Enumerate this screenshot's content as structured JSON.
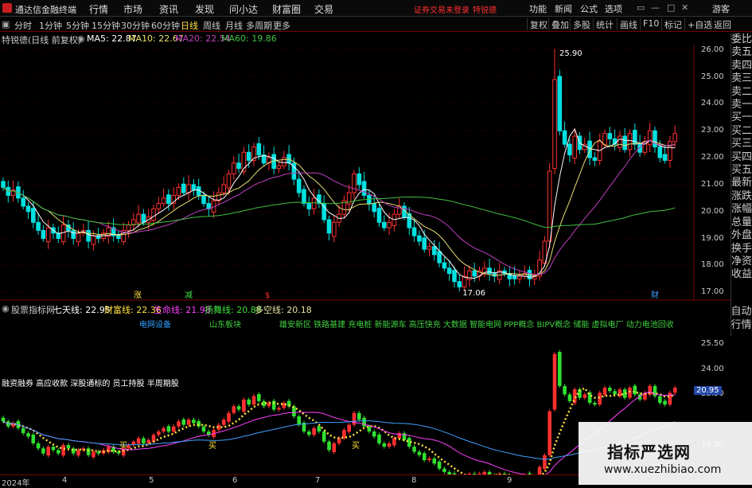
{
  "titlebar": {
    "app": "通达信金融终端",
    "menu": [
      "行情",
      "市场",
      "资讯",
      "发现",
      "问小达",
      "财富圈",
      "交易"
    ],
    "alert": "证券交易未登录",
    "stock_alert": "特锐德",
    "right": [
      "功能",
      "新闻",
      "公式",
      "选项"
    ],
    "user": "游客"
  },
  "toolbar": {
    "periods": [
      "分时",
      "1分钟",
      "5分钟",
      "15分钟",
      "30分钟",
      "60分钟",
      "日线",
      "周线",
      "月线",
      "多周期",
      "更多"
    ],
    "buttons": [
      "复权",
      "叠加",
      "多股",
      "统计",
      "画线",
      "F10",
      "标记",
      "+自选",
      "返回"
    ]
  },
  "main_info": {
    "title": "特锐德(日线 前复权)",
    "ma5": "MA5: 22.87",
    "ma10": "MA10: 22.67",
    "ma20": "MA20: 22.54",
    "ma60": "MA60: 19.86"
  },
  "price_axis": [
    "26.00",
    "25.00",
    "24.00",
    "23.00",
    "22.00",
    "21.00",
    "20.00",
    "19.00",
    "18.00",
    "17.00"
  ],
  "annotations": {
    "high": "25.90",
    "low": "17.06"
  },
  "markers": [
    "涨",
    "减",
    "$",
    "财"
  ],
  "right_sidebar": [
    "委比",
    "卖五",
    "卖四",
    "卖三",
    "卖二",
    "卖一",
    "买一",
    "买二",
    "买三",
    "买四",
    "买五",
    "最新",
    "涨跌",
    "涨幅",
    "总量",
    "外盘",
    "换手",
    "净资",
    "收益"
  ],
  "right_sidebar2": [
    "自动",
    "行情"
  ],
  "indicator": {
    "name": "股票指标网",
    "qx": "七天线: 22.95",
    "cf": "财富线: 22.36",
    "sm": "生命线: 21.98",
    "sz": "扬舞线: 20.88",
    "dk": "多空线: 20.18"
  },
  "concepts": {
    "c1": "电网设备",
    "c2": "山东板块",
    "c3": "雄安新区 铁路基建 充电桩 新能源车 高压快充 大数据 智能电网 PPP概念 BIPV概念 储能 虚拟电厂 动力电池回收"
  },
  "sub_labels": {
    "line1": "融资融券 高应收款 深股通标的 员工持股 半周期股"
  },
  "sub_axis": [
    "25.50",
    "24.00",
    "22.50",
    "20.95",
    "19.50"
  ],
  "sub_current": "20.95",
  "sub_marks": [
    "买",
    "买",
    "买"
  ],
  "date_axis": [
    "2024年",
    "4",
    "5",
    "6",
    "7",
    "8",
    "9"
  ],
  "watermark": {
    "title": "指标严选网",
    "url": "www.xuezhibiao.com"
  },
  "colors": {
    "up": "#ff3030",
    "down": "#00e0e0",
    "ma5": "#ffffff",
    "ma10": "#e8e070",
    "ma20": "#c040c0",
    "ma60": "#40c040"
  },
  "chart_data": {
    "type": "candlestick",
    "title": "特锐德(日线 前复权)",
    "ylim": [
      16.8,
      26.2
    ],
    "close": [
      20.9,
      20.6,
      20.8,
      20.5,
      20.2,
      20.0,
      19.6,
      19.3,
      19.0,
      19.4,
      19.2,
      19.0,
      19.5,
      19.3,
      19.0,
      19.2,
      19.3,
      18.9,
      19.1,
      19.0,
      19.2,
      19.4,
      19.1,
      19.0,
      19.3,
      19.5,
      19.7,
      19.9,
      19.6,
      19.8,
      20.1,
      20.3,
      20.5,
      20.3,
      20.6,
      20.9,
      20.7,
      21.0,
      20.8,
      20.6,
      20.3,
      20.1,
      20.4,
      20.7,
      21.0,
      21.4,
      21.8,
      21.6,
      22.2,
      21.9,
      22.4,
      22.1,
      21.8,
      22.0,
      21.6,
      21.7,
      22.0,
      21.8,
      21.2,
      20.7,
      20.3,
      20.1,
      20.5,
      20.3,
      19.7,
      19.2,
      19.6,
      19.9,
      20.4,
      20.7,
      21.4,
      21.0,
      20.6,
      20.3,
      20.0,
      19.6,
      19.4,
      19.6,
      19.9,
      20.2,
      19.8,
      19.4,
      19.1,
      18.9,
      18.6,
      18.7,
      18.4,
      18.1,
      17.9,
      17.7,
      17.4,
      17.2,
      17.6,
      17.8,
      17.6,
      17.8,
      17.9,
      17.7,
      17.6,
      17.8,
      17.7,
      17.5,
      17.5,
      17.6,
      17.7,
      17.5,
      17.6,
      18.2,
      18.9,
      21.5,
      24.9,
      23.0,
      22.5,
      22.1,
      22.8,
      22.3,
      22.5,
      22.0,
      21.9,
      22.6,
      22.9,
      22.7,
      22.5,
      22.8,
      22.3,
      22.9,
      22.5,
      22.2,
      22.6,
      23.0,
      22.4,
      22.0,
      21.9,
      22.6,
      22.9
    ]
  }
}
